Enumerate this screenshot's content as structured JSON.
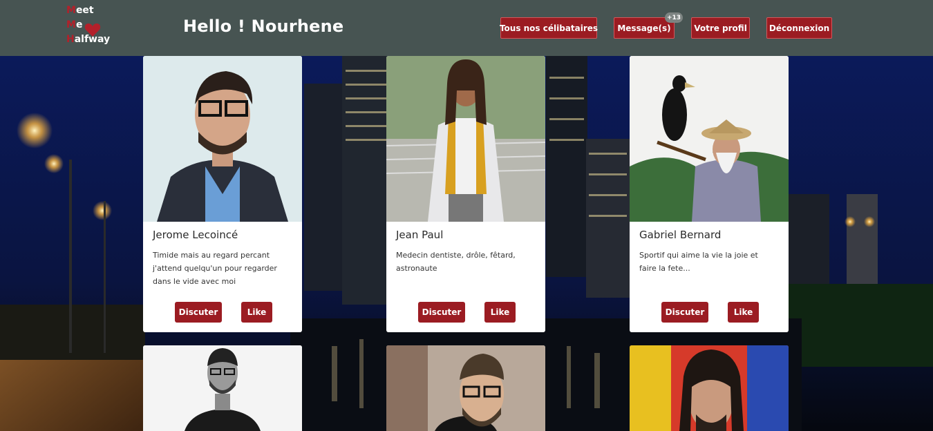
{
  "header": {
    "logo": {
      "line1_first": "M",
      "line1_rest": "eet",
      "line2_first": "M",
      "line2_rest": "e",
      "line3_first": "H",
      "line3_rest": "alfway"
    },
    "greeting": "Hello ! Nourhene",
    "nav": {
      "singles": "Tous nos célibataires",
      "messages": "Message(s)",
      "messages_badge": "+13",
      "profile": "Votre profil",
      "logout": "Déconnexion"
    }
  },
  "cards": [
    {
      "name": "Jerome Lecoincé",
      "description": "Timide mais au regard percant j'attend quelqu'un pour regarder dans le vide avec moi",
      "chat_label": "Discuter",
      "like_label": "Like"
    },
    {
      "name": "Jean Paul",
      "description": "Medecin dentiste, drôle, fêtard, astronaute",
      "chat_label": "Discuter",
      "like_label": "Like"
    },
    {
      "name": "Gabriel Bernard",
      "description": "Sportif qui aime la vie la joie et faire la fete...",
      "chat_label": "Discuter",
      "like_label": "Like"
    },
    {
      "name": "",
      "description": ""
    },
    {
      "name": "",
      "description": ""
    },
    {
      "name": "",
      "description": ""
    }
  ],
  "colors": {
    "header_bg": "#475452",
    "accent": "#9b1c22",
    "card_bg": "#ffffff"
  }
}
